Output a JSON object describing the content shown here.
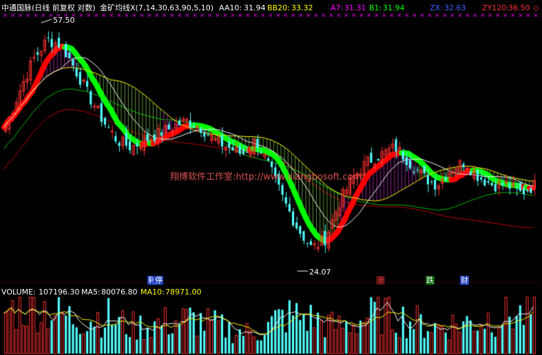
{
  "header": {
    "title": "中通国脉(日线 前复权 对数)",
    "indicator": "金矿均线X(7,14,30,63,90,5,10)",
    "aa10_label": "AA10:",
    "aa10_value": "31.94",
    "bb20_label": "BB20:",
    "bb20_value": "33.32",
    "a7_label": "A7:",
    "a7_value": "31.31",
    "b1_label": "B1:",
    "b1_value": "31.94",
    "zx_label": "ZX:",
    "zx_value": "32.63",
    "zy120_label": "ZY120:",
    "zy120_value": "36.50"
  },
  "volume_header": {
    "volume_label": "VOLUME:",
    "volume_value": "107196.30",
    "ma5_label": "MA5:",
    "ma5_value": "80076.80",
    "ma10_label": "MA10:",
    "ma10_value": "78971.00"
  },
  "annotations": {
    "high_label": "57.50",
    "low_label": "24.07",
    "watermark": "翔博软件工作室:http://www.xiangbosoft.com/",
    "events": [
      "利",
      "停",
      "涨",
      "跌",
      "财"
    ]
  },
  "colors": {
    "background": "#000000",
    "up": "#ff3232",
    "down": "#54ffff",
    "band_up": "#ff0000",
    "band_down": "#00ff00",
    "magenta": "#ff00ff",
    "yellow": "#ffff00",
    "white": "#ffffff",
    "green_line": "#00c000",
    "red_line": "#c00000"
  },
  "chart_data": {
    "type": "candlestick",
    "scale": "log",
    "x": "trading days",
    "high": 57.5,
    "low": 24.07,
    "close_path": [
      40,
      46,
      52,
      56,
      55,
      50,
      45,
      41,
      38,
      37,
      38,
      39,
      40,
      41,
      40,
      38,
      37,
      36,
      38,
      34,
      30,
      27,
      25,
      26,
      30,
      33,
      35,
      36,
      37,
      35,
      33,
      32,
      34,
      35,
      33,
      32,
      32,
      31,
      31.94
    ],
    "volume_path": [
      110,
      120,
      130,
      115,
      100,
      90,
      95,
      100,
      80,
      70,
      75,
      80,
      85,
      90,
      80,
      70,
      60,
      55,
      60,
      90,
      100,
      95,
      85,
      70,
      75,
      90,
      110,
      100,
      90,
      80,
      70,
      75,
      80,
      85,
      95,
      105,
      100,
      107
    ]
  }
}
